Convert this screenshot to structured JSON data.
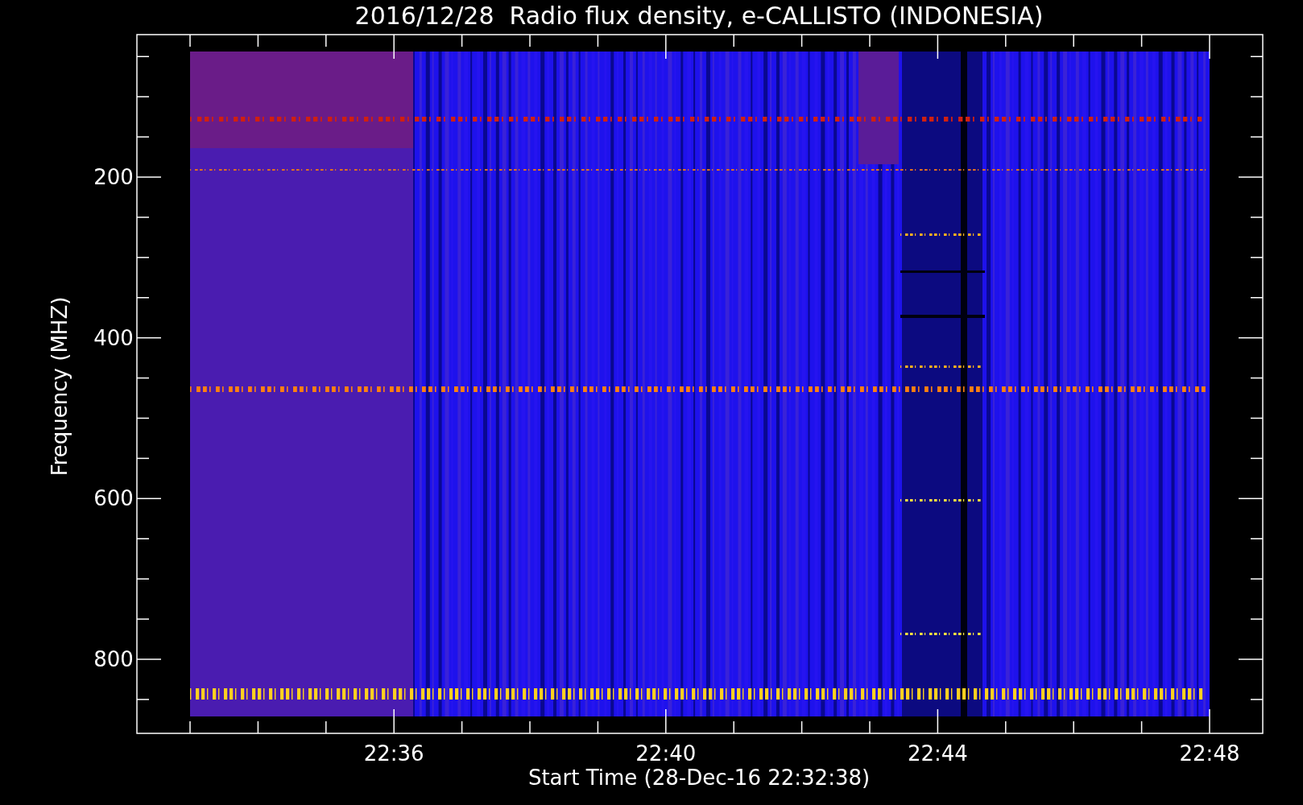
{
  "title": "2016/12/28  Radio flux density, e-CALLISTO (INDONESIA)",
  "y_axis": {
    "label": "Frequency (MHZ)",
    "ticks": [
      "200",
      "400",
      "600",
      "800"
    ]
  },
  "x_axis": {
    "label": "Start Time (28-Dec-16 22:32:38)",
    "ticks": [
      "22:36",
      "22:40",
      "22:44",
      "22:48"
    ]
  }
}
